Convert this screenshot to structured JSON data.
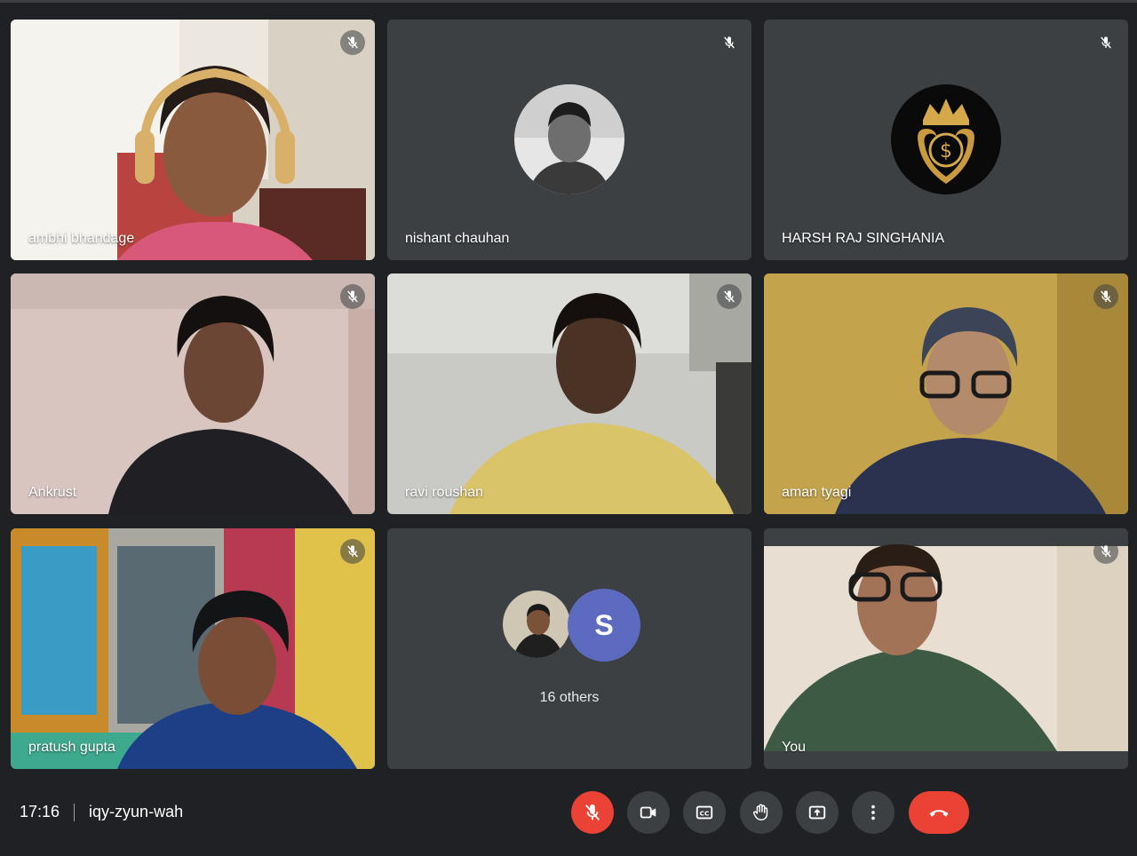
{
  "colors": {
    "background": "#202124",
    "tile": "#3c4043",
    "danger": "#ea4335",
    "avatar_letter_bg": "#5c6bc0"
  },
  "participants": [
    {
      "name": "ambhi bhandage",
      "muted": true,
      "video": "camera"
    },
    {
      "name": "nishant chauhan",
      "muted": true,
      "video": "profile-photo"
    },
    {
      "name": "HARSH RAJ SINGHANIA",
      "muted": true,
      "video": "crown-dollar-logo"
    },
    {
      "name": "Ankrust",
      "muted": true,
      "video": "camera"
    },
    {
      "name": "ravi roushan",
      "muted": true,
      "video": "camera"
    },
    {
      "name": "aman tyagi",
      "muted": true,
      "video": "camera"
    },
    {
      "name": "pratush gupta",
      "muted": true,
      "video": "camera"
    },
    {
      "name": "You",
      "muted": true,
      "video": "camera"
    }
  ],
  "others": {
    "avatar_letter": "S",
    "label": "16 others"
  },
  "bottom_bar": {
    "time": "17:16",
    "meeting_code": "iqy-zyun-wah"
  },
  "controls": [
    {
      "icon": "mic-off-icon",
      "active_danger": true
    },
    {
      "icon": "video-camera-icon"
    },
    {
      "icon": "captions-icon"
    },
    {
      "icon": "raise-hand-icon"
    },
    {
      "icon": "present-screen-icon"
    },
    {
      "icon": "more-options-icon"
    },
    {
      "icon": "end-call-icon",
      "active_danger": true
    }
  ]
}
